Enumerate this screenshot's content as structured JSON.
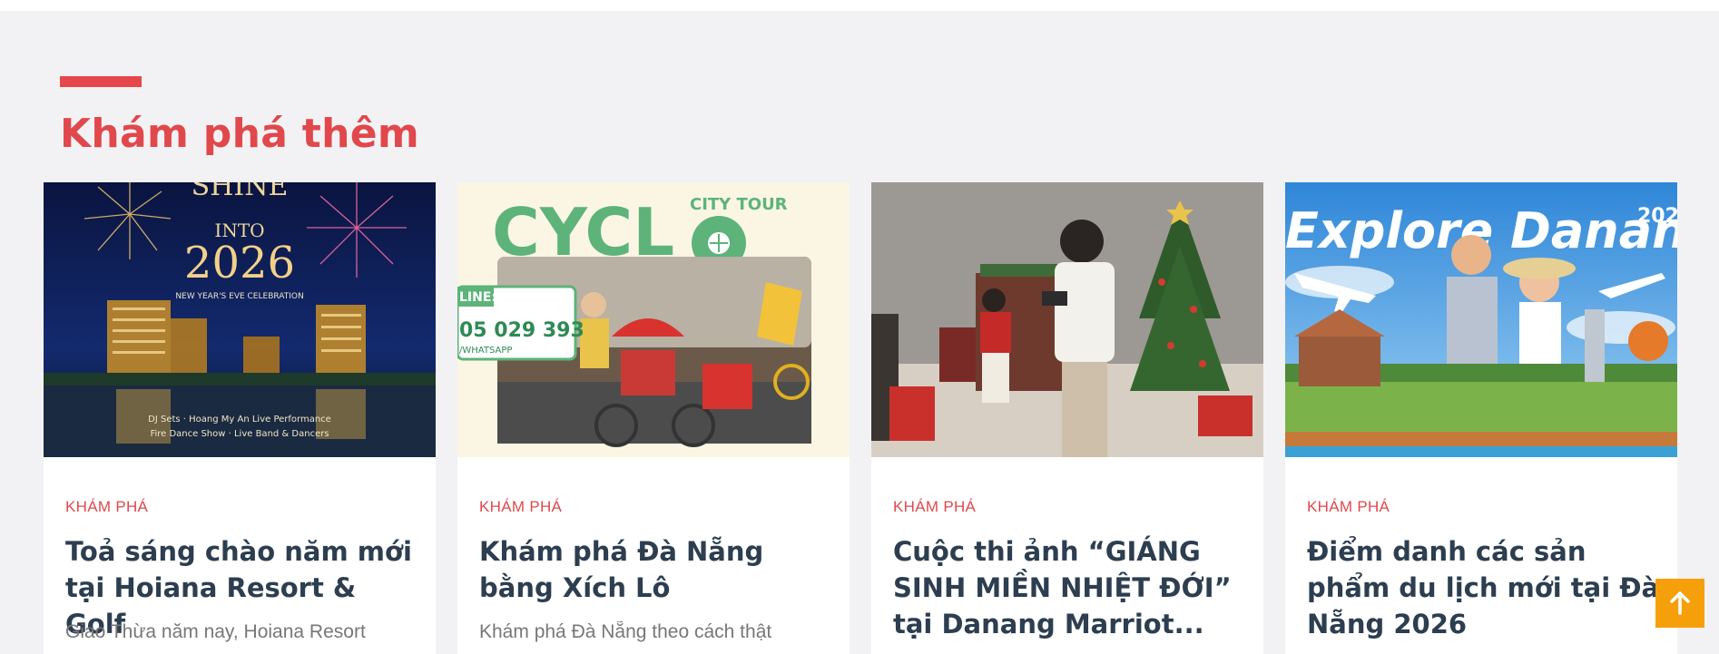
{
  "section": {
    "title": "Khám phá thêm"
  },
  "cards": [
    {
      "category": "KHÁM PHÁ",
      "title": "Toả sáng chào năm mới tại Hoiana Resort & Golf",
      "excerpt": "Giao Thừa năm nay, Hoiana Resort",
      "image_text": {
        "line1": "SHINE",
        "line2": "INTO",
        "year": "2026",
        "subtitle": "NEW YEAR'S EVE CELEBRATION",
        "bottom1": "DJ Sets · Hoang My An Live Performance",
        "bottom2": "Fire Dance Show · Live Band & Dancers"
      }
    },
    {
      "category": "KHÁM PHÁ",
      "title": "Khám phá Đà Nẵng bằng Xích Lô",
      "excerpt": "Khám phá Đà Nẵng theo cách thật",
      "image_text": {
        "brand": "CYCL",
        "tag": "CITY TOUR",
        "hotline_label": "LINE:",
        "hotline": "05 029 393",
        "whatsapp": "/WHATSAPP"
      }
    },
    {
      "category": "KHÁM PHÁ",
      "title": "Cuộc thi ảnh “GIÁNG SINH MIỀN NHIỆT ĐỚI” tại Danang Marriot...",
      "excerpt": ""
    },
    {
      "category": "KHÁM PHÁ",
      "title": "Điểm danh các sản phẩm du lịch mới tại Đà Nẵng 2026",
      "excerpt": "",
      "image_text": {
        "headline": "Explore Danang",
        "year": "202"
      }
    }
  ],
  "colors": {
    "accent": "#e5474b",
    "title": "#2c3e50",
    "scroll_button": "#f5a00b"
  },
  "scroll_top": {
    "icon": "arrow-up-icon"
  }
}
